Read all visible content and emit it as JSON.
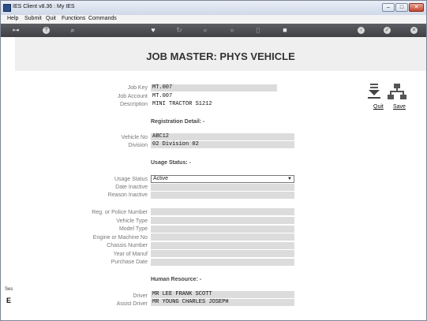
{
  "window": {
    "title": "IES Client v8.36 : My IES",
    "minimize": "–",
    "maximize": "□",
    "close": "✕"
  },
  "menu": {
    "items": [
      "Help",
      "Submit",
      "Quit",
      "Functions",
      "Commands"
    ]
  },
  "toolbar": {
    "icons": [
      "key-icon",
      "help-icon",
      "search-icon",
      "heart-icon",
      "refresh-icon",
      "rewind-icon",
      "fast-forward-icon",
      "delete-icon",
      "save-icon",
      "back-icon",
      "ok-icon",
      "close-icon"
    ]
  },
  "page": {
    "title": "JOB MASTER: PHYS VEHICLE"
  },
  "actions": {
    "quit": "Quit",
    "save": "Save"
  },
  "job": {
    "key_label": "Job Key",
    "key": "MT.007",
    "account_label": "Job Account",
    "account": "MT.007",
    "description_label": "Description",
    "description": "MINI TRACTOR S1212"
  },
  "registration": {
    "heading": "Registration Detail: -",
    "vehicle_no_label": "Vehicle No",
    "vehicle_no": "ABC12",
    "division_label": "Division",
    "division": "02 Division 02"
  },
  "usage": {
    "heading": "Usage Status: -",
    "status_label": "Usage Status",
    "status": "Active",
    "date_inactive_label": "Date Inactive",
    "date_inactive": "",
    "reason_inactive_label": "Reason Inactive",
    "reason_inactive": ""
  },
  "details": {
    "reg_label": "Reg. or Police Number",
    "reg": "",
    "vehicle_type_label": "Vehicle Type",
    "vehicle_type": "",
    "model_type_label": "Model Type",
    "model_type": "",
    "engine_label": "Engine or Machine No",
    "engine": "",
    "chassis_label": "Chassis Number",
    "chassis": "",
    "year_label": "Year of Manuf",
    "year": "",
    "purchase_label": "Purchase Date",
    "purchase": ""
  },
  "human_resource": {
    "heading": "Human Resource: -",
    "driver_label": "Driver",
    "driver": "MR LEE FRANK SCOTT",
    "assist_label": "Assist Driver",
    "assist": "MR YOUNG CHARLES JOSEPH"
  },
  "left_panel": {
    "label": "Ses",
    "glyph": "E"
  }
}
